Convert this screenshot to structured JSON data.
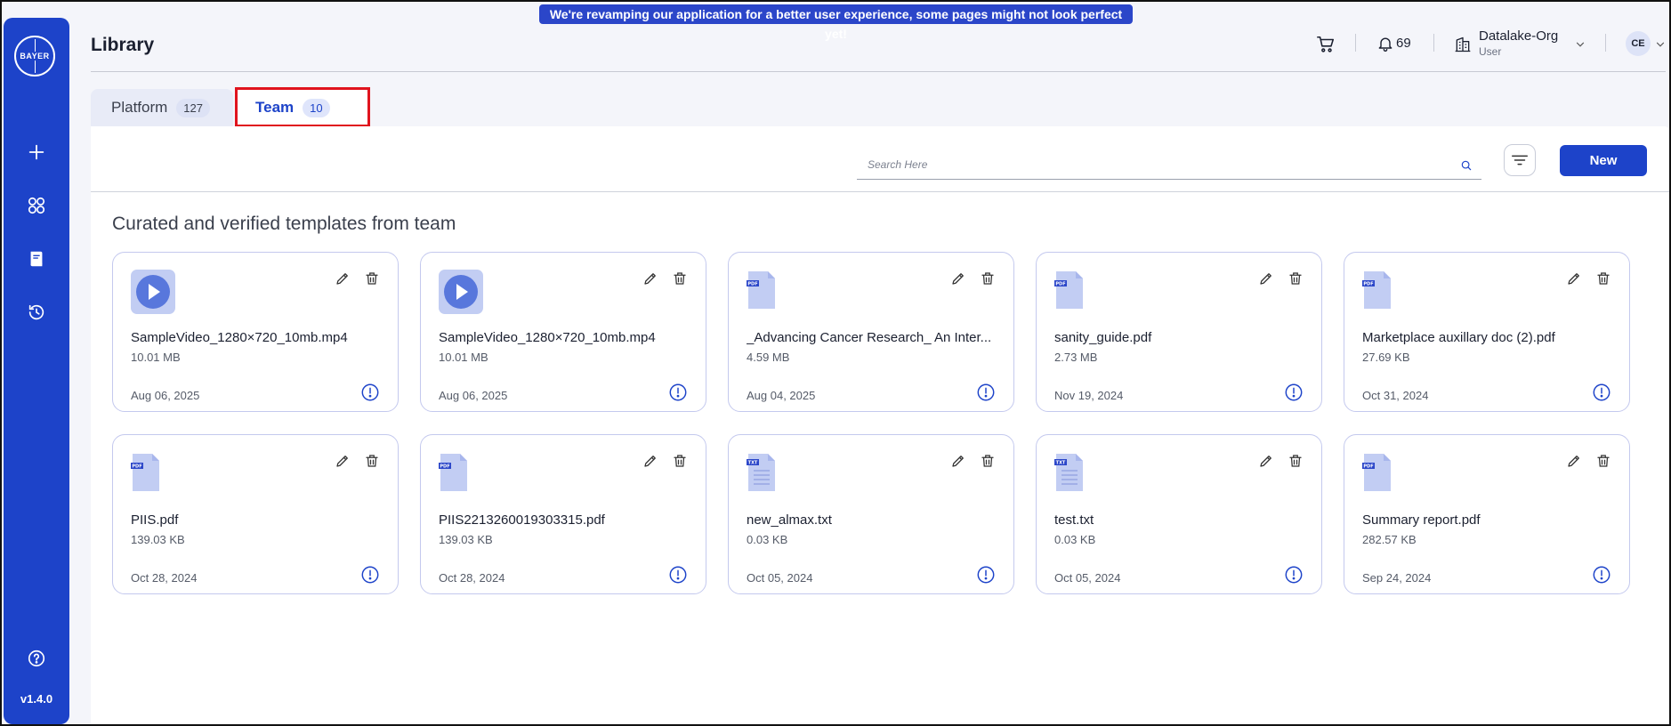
{
  "banner": "We're revamping our application for a better user experience, some pages might not look perfect yet!",
  "sidebar": {
    "logo": "BAYER",
    "items": [
      {
        "name": "add",
        "icon": "plus-icon"
      },
      {
        "name": "apps",
        "icon": "grid-icon"
      },
      {
        "name": "library",
        "icon": "book-icon"
      },
      {
        "name": "history",
        "icon": "history-icon"
      }
    ],
    "help_icon": "help-icon",
    "version": "v1.4.0"
  },
  "header": {
    "title": "Library",
    "notifications": "69",
    "org_name": "Datalake-Org",
    "org_role": "User",
    "avatar": "CE"
  },
  "tabs": [
    {
      "label": "Platform",
      "count": "127",
      "active": false
    },
    {
      "label": "Team",
      "count": "10",
      "active": true
    }
  ],
  "toolbar": {
    "search_placeholder": "Search Here",
    "new_label": "New"
  },
  "section_title": "Curated and verified templates from team",
  "cards": [
    {
      "type": "video",
      "name": "SampleVideo_1280×720_10mb.mp4",
      "size": "10.01 MB",
      "date": "Aug 06, 2025"
    },
    {
      "type": "video",
      "name": "SampleVideo_1280×720_10mb.mp4",
      "size": "10.01 MB",
      "date": "Aug 06, 2025"
    },
    {
      "type": "pdf",
      "name": "_Advancing Cancer Research_ An Inter...",
      "size": "4.59 MB",
      "date": "Aug 04, 2025"
    },
    {
      "type": "pdf",
      "name": "sanity_guide.pdf",
      "size": "2.73 MB",
      "date": "Nov 19, 2024"
    },
    {
      "type": "pdf",
      "name": "Marketplace auxillary doc (2).pdf",
      "size": "27.69 KB",
      "date": "Oct 31, 2024"
    },
    {
      "type": "pdf",
      "name": "PIIS.pdf",
      "size": "139.03 KB",
      "date": "Oct 28, 2024"
    },
    {
      "type": "pdf",
      "name": "PIIS2213260019303315.pdf",
      "size": "139.03 KB",
      "date": "Oct 28, 2024"
    },
    {
      "type": "txt",
      "name": "new_almax.txt",
      "size": "0.03 KB",
      "date": "Oct 05, 2024"
    },
    {
      "type": "txt",
      "name": "test.txt",
      "size": "0.03 KB",
      "date": "Oct 05, 2024"
    },
    {
      "type": "pdf",
      "name": "Summary report.pdf",
      "size": "282.57 KB",
      "date": "Sep 24, 2024"
    }
  ],
  "colors": {
    "primary": "#1d43c9",
    "highlight": "#e0141e",
    "card_border": "#c4c9ee"
  }
}
